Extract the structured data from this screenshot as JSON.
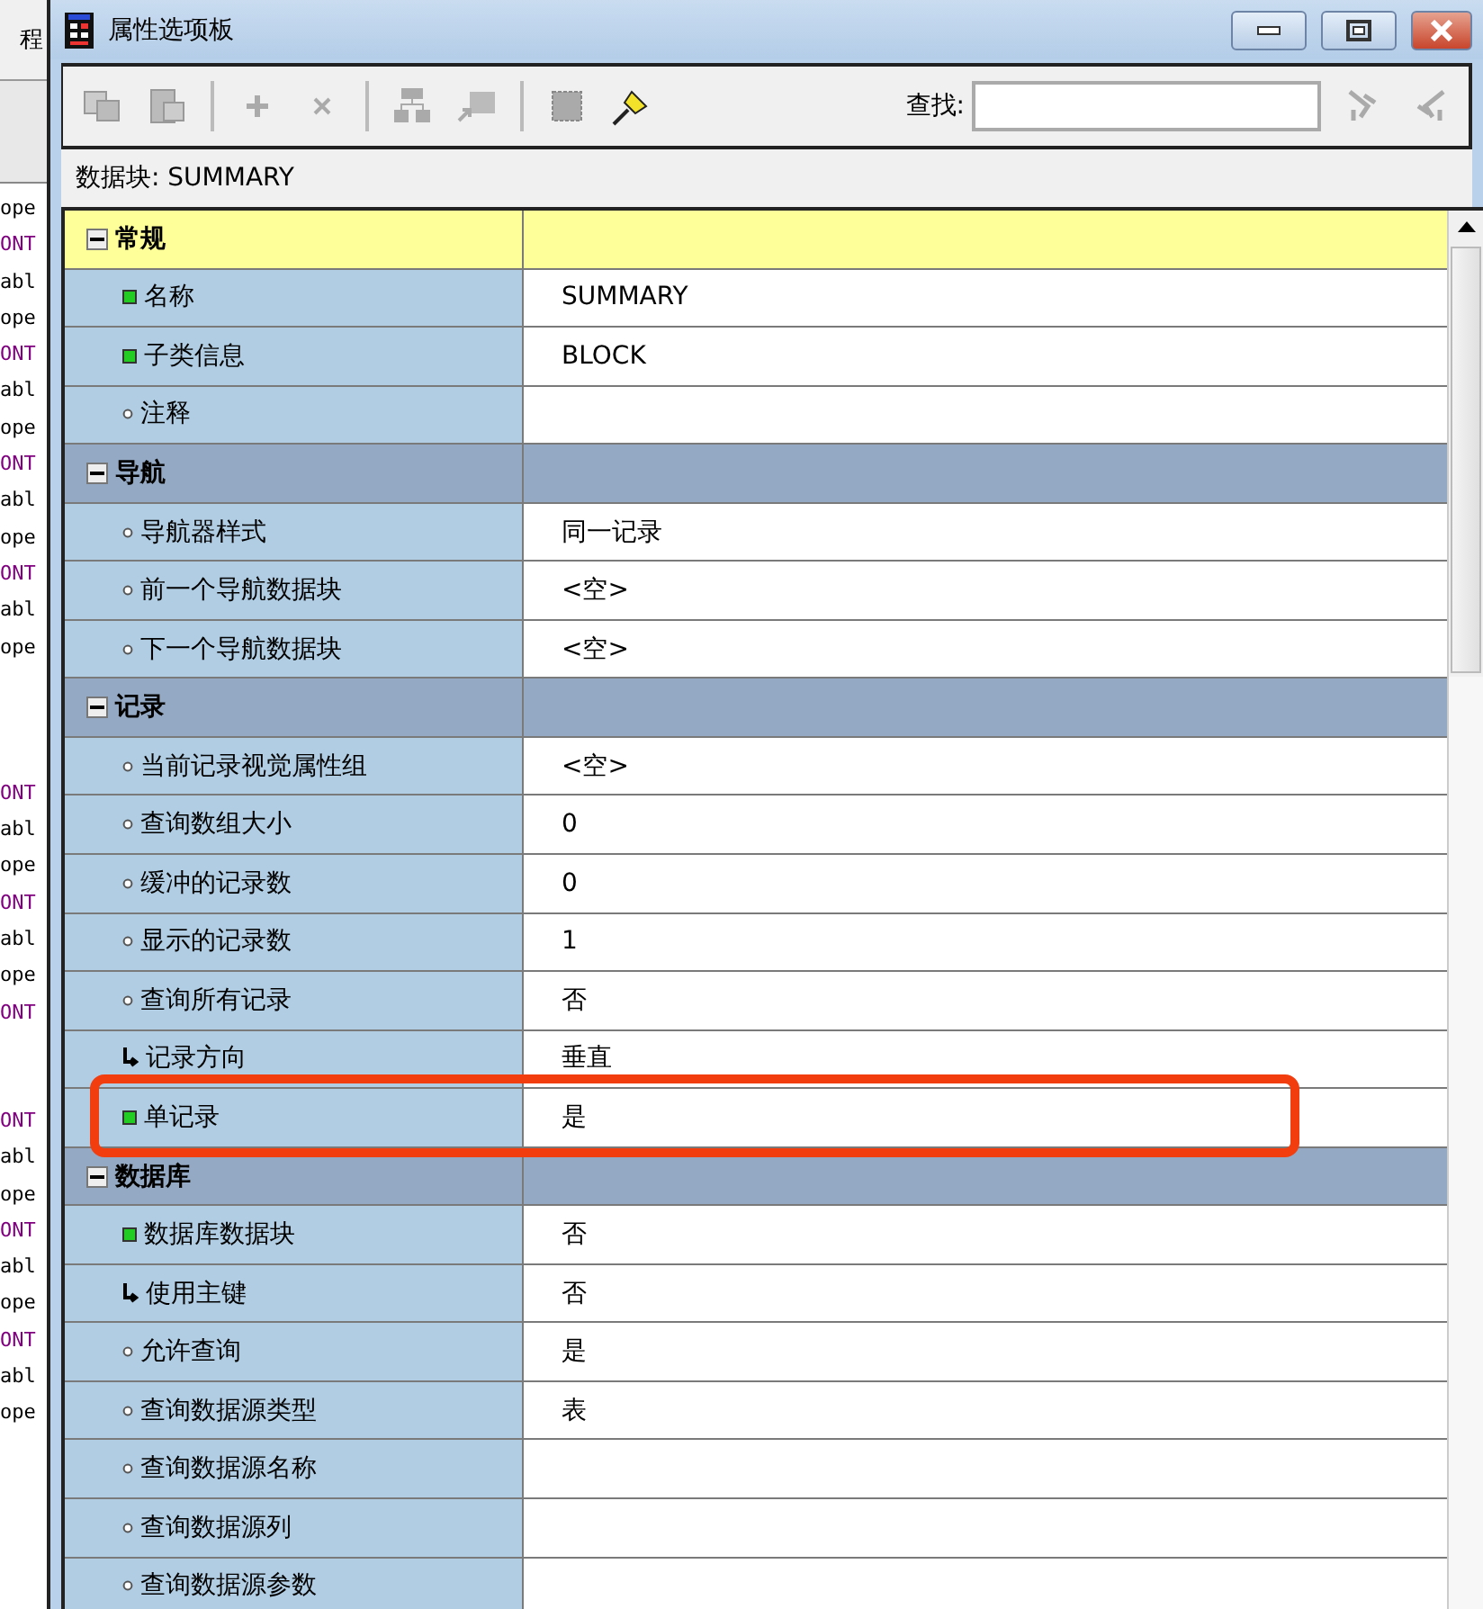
{
  "background_editor": {
    "tab_text": "程",
    "code_blocks": [
      {
        "lines": [
          {
            "text": "ope",
            "kind": "plain"
          },
          {
            "text": "ONT",
            "kind": "keyword"
          },
          {
            "text": "abl",
            "kind": "plain"
          },
          {
            "text": "ope",
            "kind": "plain"
          },
          {
            "text": "ONT",
            "kind": "keyword"
          },
          {
            "text": "abl",
            "kind": "plain"
          },
          {
            "text": "ope",
            "kind": "plain"
          },
          {
            "text": "ONT",
            "kind": "keyword"
          },
          {
            "text": "abl",
            "kind": "plain"
          },
          {
            "text": "ope",
            "kind": "plain"
          },
          {
            "text": "ONT",
            "kind": "keyword"
          },
          {
            "text": "abl",
            "kind": "plain"
          },
          {
            "text": "ope",
            "kind": "plain"
          }
        ]
      },
      {
        "lines": [
          {
            "text": "ONT",
            "kind": "keyword"
          },
          {
            "text": "abl",
            "kind": "plain"
          },
          {
            "text": "ope",
            "kind": "plain"
          },
          {
            "text": "ONT",
            "kind": "keyword"
          },
          {
            "text": "abl",
            "kind": "plain"
          },
          {
            "text": "ope",
            "kind": "plain"
          },
          {
            "text": "ONT",
            "kind": "keyword"
          }
        ]
      },
      {
        "lines": [
          {
            "text": "ONT",
            "kind": "keyword"
          },
          {
            "text": "abl",
            "kind": "plain"
          },
          {
            "text": "ope",
            "kind": "plain"
          },
          {
            "text": "ONT",
            "kind": "keyword"
          },
          {
            "text": "abl",
            "kind": "plain"
          },
          {
            "text": "ope",
            "kind": "plain"
          },
          {
            "text": "ONT",
            "kind": "keyword"
          },
          {
            "text": "abl",
            "kind": "plain"
          },
          {
            "text": "ope",
            "kind": "plain"
          }
        ]
      }
    ]
  },
  "window": {
    "title": "属性选项板"
  },
  "toolbar": {
    "search": {
      "label": "查找:"
    }
  },
  "header": "数据块: SUMMARY",
  "properties": [
    {
      "kind": "section",
      "label": "常规",
      "selected": true,
      "highlighted": false
    },
    {
      "kind": "set_property",
      "label": "名称",
      "value": "SUMMARY",
      "highlighted": false
    },
    {
      "kind": "set_property",
      "label": "子类信息",
      "value": "BLOCK",
      "highlighted": false
    },
    {
      "kind": "default_property",
      "label": "注释",
      "highlighted": false
    },
    {
      "kind": "section",
      "label": "导航",
      "selected": false,
      "highlighted": false
    },
    {
      "kind": "default_property",
      "label": "导航器样式",
      "value": "同一记录",
      "highlighted": false
    },
    {
      "kind": "default_property",
      "label": "前一个导航数据块",
      "value": "<空>",
      "highlighted": false
    },
    {
      "kind": "default_property",
      "label": "下一个导航数据块",
      "value": "<空>",
      "highlighted": false
    },
    {
      "kind": "section",
      "label": "记录",
      "selected": false,
      "highlighted": false
    },
    {
      "kind": "default_property",
      "label": "当前记录视觉属性组",
      "value": "<空>",
      "highlighted": false
    },
    {
      "kind": "default_property",
      "label": "查询数组大小",
      "value": "0",
      "highlighted": false
    },
    {
      "kind": "default_property",
      "label": "缓冲的记录数",
      "value": "0",
      "highlighted": false
    },
    {
      "kind": "default_property",
      "label": "显示的记录数",
      "value": "1",
      "highlighted": false
    },
    {
      "kind": "default_property",
      "label": "查询所有记录",
      "value": "否",
      "highlighted": false
    },
    {
      "kind": "inherited_property",
      "label": "记录方向",
      "value": "垂直",
      "highlighted": false
    },
    {
      "kind": "set_property",
      "label": "单记录",
      "value": "是",
      "highlighted": true
    },
    {
      "kind": "section",
      "label": "数据库",
      "selected": false,
      "highlighted": false
    },
    {
      "kind": "set_property",
      "label": "数据库数据块",
      "value": "否",
      "highlighted": false
    },
    {
      "kind": "inherited_property",
      "label": "使用主键",
      "value": "否",
      "highlighted": false
    },
    {
      "kind": "default_property",
      "label": "允许查询",
      "value": "是",
      "highlighted": false
    },
    {
      "kind": "default_property",
      "label": "查询数据源类型",
      "value": "表",
      "highlighted": false
    },
    {
      "kind": "default_property",
      "label": "查询数据源名称",
      "highlighted": false
    },
    {
      "kind": "default_property",
      "label": "查询数据源列",
      "highlighted": false
    },
    {
      "kind": "default_property",
      "label": "查询数据源参数",
      "highlighted": false
    }
  ]
}
